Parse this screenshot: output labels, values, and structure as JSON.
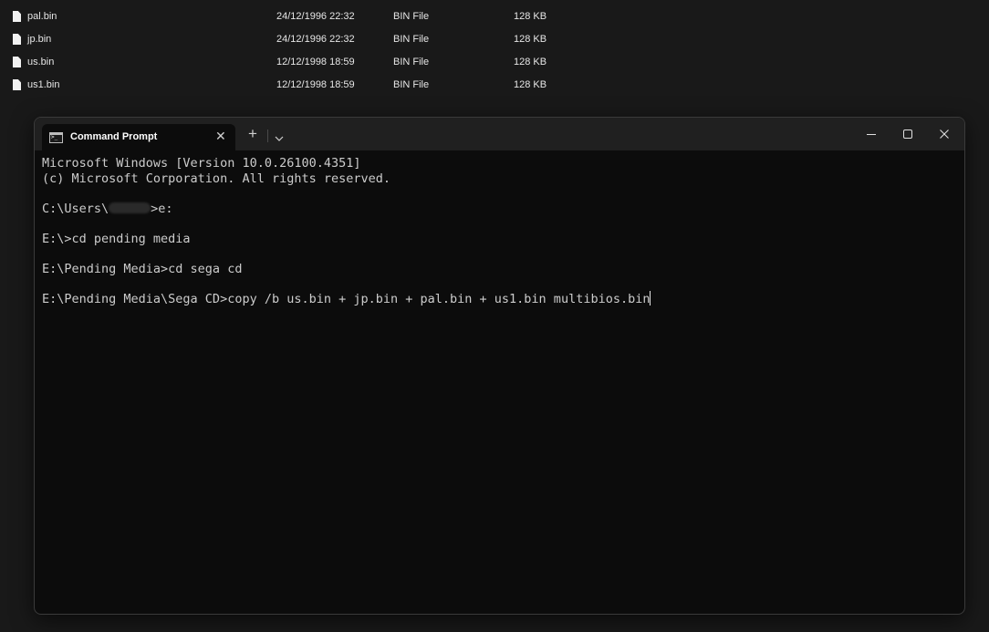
{
  "explorer": {
    "files": [
      {
        "name": "pal.bin",
        "date": "24/12/1996 22:32",
        "type": "BIN File",
        "size": "128 KB"
      },
      {
        "name": "jp.bin",
        "date": "24/12/1996 22:32",
        "type": "BIN File",
        "size": "128 KB"
      },
      {
        "name": "us.bin",
        "date": "12/12/1998 18:59",
        "type": "BIN File",
        "size": "128 KB"
      },
      {
        "name": "us1.bin",
        "date": "12/12/1998 18:59",
        "type": "BIN File",
        "size": "128 KB"
      }
    ]
  },
  "terminal": {
    "tab_title": "Command Prompt",
    "tab_icon": "command-prompt-icon",
    "close_tab_glyph": "✕",
    "new_tab_glyph": "+",
    "lines": {
      "l1": "Microsoft Windows [Version 10.0.26100.4351]",
      "l2": "(c) Microsoft Corporation. All rights reserved.",
      "l3_prefix": "C:\\Users\\",
      "l3_suffix": ">e:",
      "l4": "E:\\>cd pending media",
      "l5": "E:\\Pending Media>cd sega cd",
      "l6": "E:\\Pending Media\\Sega CD>copy /b us.bin + jp.bin + pal.bin + us1.bin multibios.bin"
    },
    "colors": {
      "background": "#0c0c0c",
      "text": "#cccccc",
      "titlebar": "#202020"
    }
  }
}
